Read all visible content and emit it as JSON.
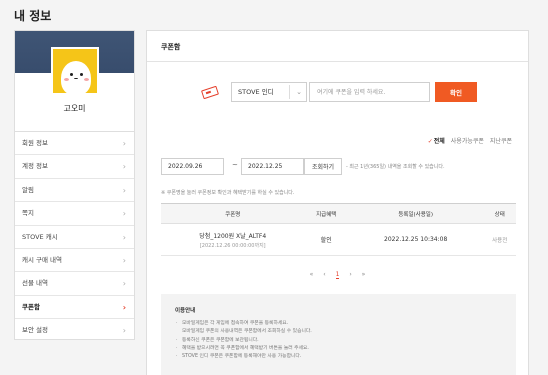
{
  "page": {
    "title": "내 정보"
  },
  "profile": {
    "name": "고오미"
  },
  "sidebar": {
    "items": [
      {
        "label": "회원 정보",
        "active": false
      },
      {
        "label": "계정 정보",
        "active": false
      },
      {
        "label": "알림",
        "active": false
      },
      {
        "label": "쪽지",
        "active": false
      },
      {
        "label": "STOVE 캐시",
        "active": false
      },
      {
        "label": "캐시 구매 내역",
        "active": false
      },
      {
        "label": "선물 내역",
        "active": false
      },
      {
        "label": "쿠폰함",
        "active": true
      },
      {
        "label": "보안 설정",
        "active": false
      }
    ],
    "chevron": "›"
  },
  "main": {
    "title": "쿠폰함",
    "register": {
      "platform": "STOVE 인디",
      "placeholder": "여기에 쿠폰을 입력 하세요.",
      "confirm_label": "확인"
    },
    "filters": {
      "check": "✓",
      "all": "전체",
      "usable": "사용가능쿠폰",
      "past": "지난쿠폰"
    },
    "dates": {
      "start": "2022.09.26",
      "end": "2022.12.25",
      "dash": "~",
      "search_label": "조회하기",
      "note": "- 최근 1년(365일) 내역을 조회할 수 있습니다."
    },
    "table_note": "※ 쿠폰명을 눌러 쿠폰정보 확인과 혜택받기를 하실 수 있습니다.",
    "table": {
      "headers": [
        "쿠폰명",
        "지급혜택",
        "등록일(사용일)",
        "상태"
      ],
      "rows": [
        {
          "name": "당첨_1200원 X날_ALTF4",
          "period": "[2022.12.26 00:00:00까지]",
          "benefit": "할인",
          "date": "2022.12.25 10:34:08",
          "status": "사용전"
        }
      ]
    },
    "pager": {
      "first": "«",
      "prev": "‹",
      "current": "1",
      "next": "›",
      "last": "»"
    },
    "notice": {
      "title": "이용안내",
      "items": [
        "모바일게임은 각 게임에 접속하여 쿠폰을 등록하세요.",
        "모바일게임 쿠폰의 사용내역은 쿠폰함에서 조회하실 수 있습니다.",
        "등록하신 쿠폰은 쿠폰함에 보관됩니다.",
        "혜택을 받으시려면 꼭 쿠폰함에서 혜택받기 버튼을 눌러 주세요.",
        "STOVE 인디 쿠폰은 쿠폰함에 등록해야만 사용 가능합니다."
      ]
    }
  }
}
